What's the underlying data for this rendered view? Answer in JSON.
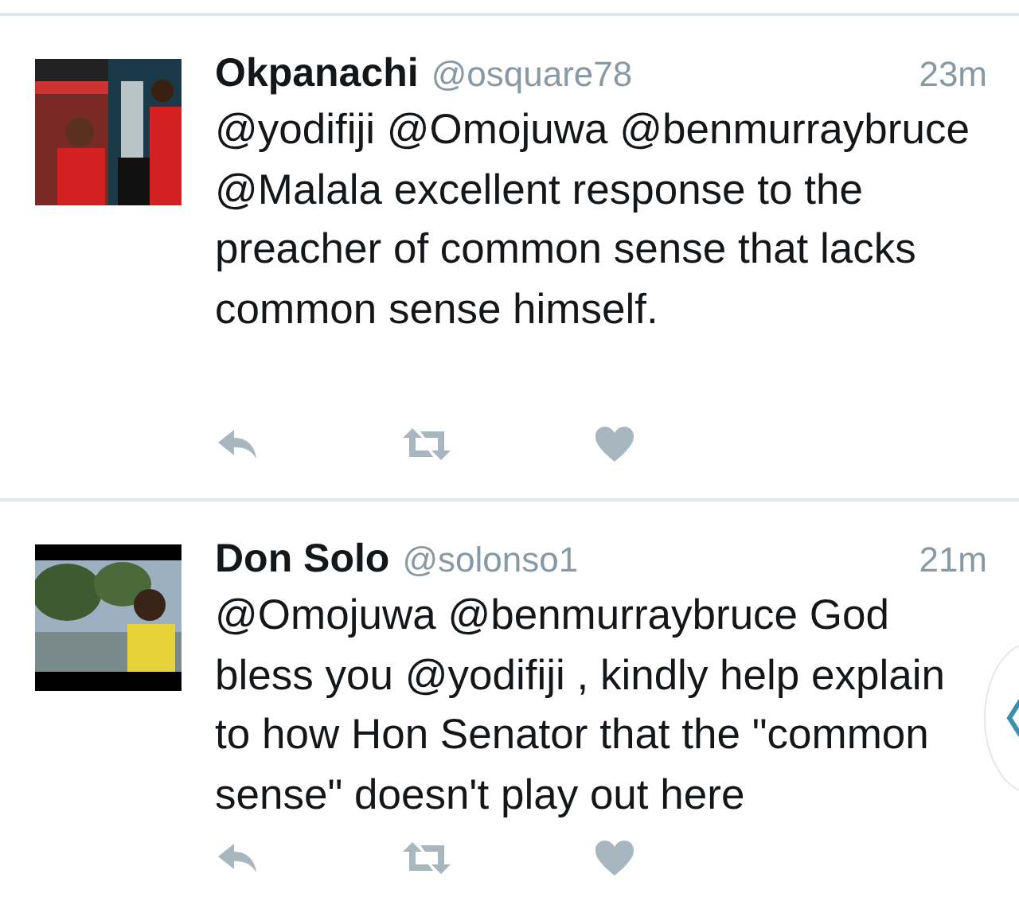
{
  "tweets": [
    {
      "name": "Okpanachi",
      "handle": "@osquare78",
      "time": "23m",
      "text": "@yodifiji @Omojuwa @benmurraybruce @Malala excellent response to the preacher of common sense that lacks common sense himself."
    },
    {
      "name": "Don Solo",
      "handle": "@solonso1",
      "time": "21m",
      "text": "@Omojuwa @benmurraybruce God bless you @yodifiji , kindly help explain to how Hon Senator that the \"common sense\" doesn't play out here"
    }
  ]
}
